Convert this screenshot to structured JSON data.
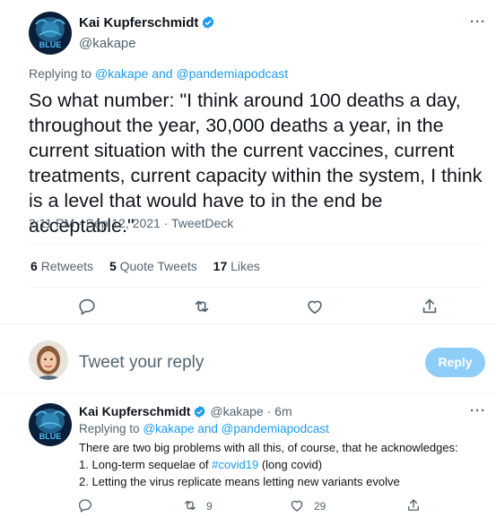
{
  "main_tweet": {
    "author_name": "Kai Kupferschmidt",
    "author_handle": "@kakape",
    "avatar_text": "BLUE",
    "more_label": "···",
    "replying_prefix": "Replying to",
    "replying_handle_1": "@kakape",
    "replying_and": "and",
    "replying_handle_2": "@pandemiapodcast",
    "text": "So what number: \"I think around 100 deaths a day, throughout the year, 30,000 deaths a year, in the current situation with the current vaccines, current treatments, current capacity within the system, I think is a level that would have to in the end be acceptable.\"",
    "timestamp": "2:11 PM · Sep 12, 2021 · TweetDeck",
    "stats": {
      "retweets_count": "6",
      "retweets_label": "Retweets",
      "quotes_count": "5",
      "quotes_label": "Quote Tweets",
      "likes_count": "17",
      "likes_label": "Likes"
    }
  },
  "composer": {
    "placeholder": "Tweet your reply",
    "reply_button": "Reply"
  },
  "reply_tweet": {
    "author_name": "Kai Kupferschmidt",
    "author_handle": "@kakape",
    "time": "· 6m",
    "more_label": "···",
    "replying_prefix": "Replying to",
    "replying_handle_1": "@kakape",
    "replying_and": "and",
    "replying_handle_2": "@pandemiapodcast",
    "line1": "There are two big problems with all this, of course, that he acknowledges:",
    "line2_prefix": "1. Long-term sequelae of",
    "line2_hashtag": "#covid19",
    "line2_suffix": "(long covid)",
    "line3": "2. Letting the virus replicate means letting new variants evolve",
    "retweet_count": "9",
    "like_count": "29"
  },
  "colors": {
    "accent": "#1d9bf0",
    "secondary_text": "#536471",
    "reply_button_disabled": "#8ecdf8",
    "divider": "#eff3f4"
  },
  "icons": [
    "verified-badge-icon",
    "more-icon",
    "reply-icon",
    "retweet-icon",
    "like-icon",
    "share-icon"
  ]
}
